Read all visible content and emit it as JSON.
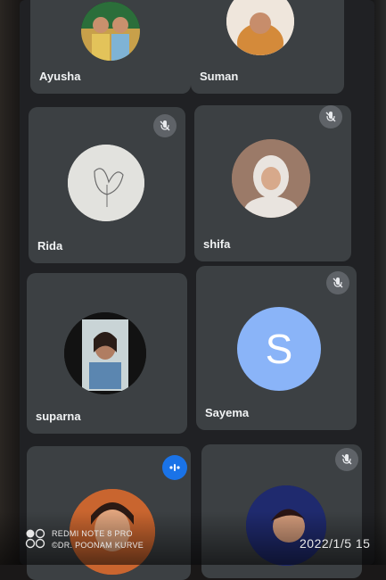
{
  "participants": [
    {
      "name": "Ayusha"
    },
    {
      "name": "Suman"
    },
    {
      "name": "Rida",
      "mic": "muted"
    },
    {
      "name": "shifa",
      "mic": "muted"
    },
    {
      "name": "suparna"
    },
    {
      "name": "Sayema",
      "initial": "S",
      "mic": "muted"
    },
    {
      "name": "",
      "mic": "speaking"
    },
    {
      "name": "",
      "mic": "muted"
    }
  ],
  "icons": {
    "mic_off": "mic-off-icon",
    "speaking": "audio-level-icon"
  },
  "colors": {
    "tile_bg": "#3c4043",
    "screen_bg": "#202124",
    "muted_badge": "#5f6368",
    "speaking_badge": "#1a73e8",
    "sayema_avatar": "#8ab4f8"
  },
  "watermark": {
    "device": "REDMI NOTE 8 PRO",
    "credit": "©DR. POONAM KURVE",
    "date": "2022/1/5  15"
  }
}
